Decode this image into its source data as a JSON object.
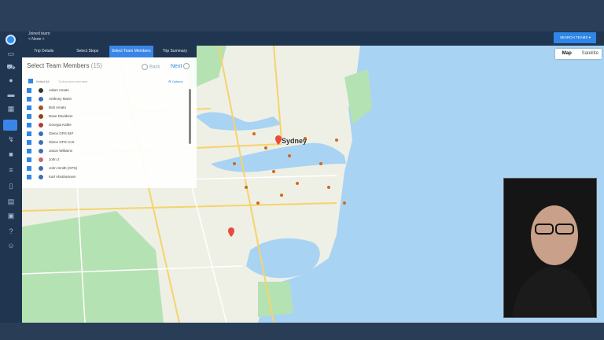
{
  "header": {
    "joined_label": "Joined team:",
    "joined_value": "< None >",
    "search_teams": "SEARCH TEAMS"
  },
  "tabs": [
    {
      "label": "Trip Details"
    },
    {
      "label": "Select Stops"
    },
    {
      "label": "Select Team Members",
      "active": true
    },
    {
      "label": "Trip Summary"
    }
  ],
  "panel": {
    "title": "Select Team Members",
    "count": "(15)",
    "back": "Back",
    "next": "Next",
    "select_all": "Select All",
    "search_placeholder": "To find team member",
    "options": "Options"
  },
  "members": [
    {
      "name": "Adam Amato"
    },
    {
      "name": "Anthony Marin"
    },
    {
      "name": "Bob Amato"
    },
    {
      "name": "Dave Davidson"
    },
    {
      "name": "Georgia Kahle"
    },
    {
      "name": "Glenn GPS 567"
    },
    {
      "name": "Glenn GPS Cort"
    },
    {
      "name": "Jason Williams"
    },
    {
      "name": "John 2"
    },
    {
      "name": "John Smith (GPS)"
    },
    {
      "name": "Karl Abrahamsen"
    }
  ],
  "map": {
    "city_label": "Sydney",
    "type_map": "Map",
    "type_satellite": "Satellite"
  },
  "colors": {
    "accent": "#3a86e8",
    "sidebar": "#1f3550",
    "water": "#a9d3f2",
    "land": "#eef0e6",
    "park": "#b5e2b3"
  },
  "icons": [
    "logo-icon",
    "dashboard-icon",
    "truck-icon",
    "location-icon",
    "car-icon",
    "calendar-icon",
    "trip-icon",
    "route-icon",
    "briefcase-icon",
    "list-icon",
    "document-icon",
    "report-icon",
    "box-icon",
    "help-icon",
    "users-icon"
  ]
}
